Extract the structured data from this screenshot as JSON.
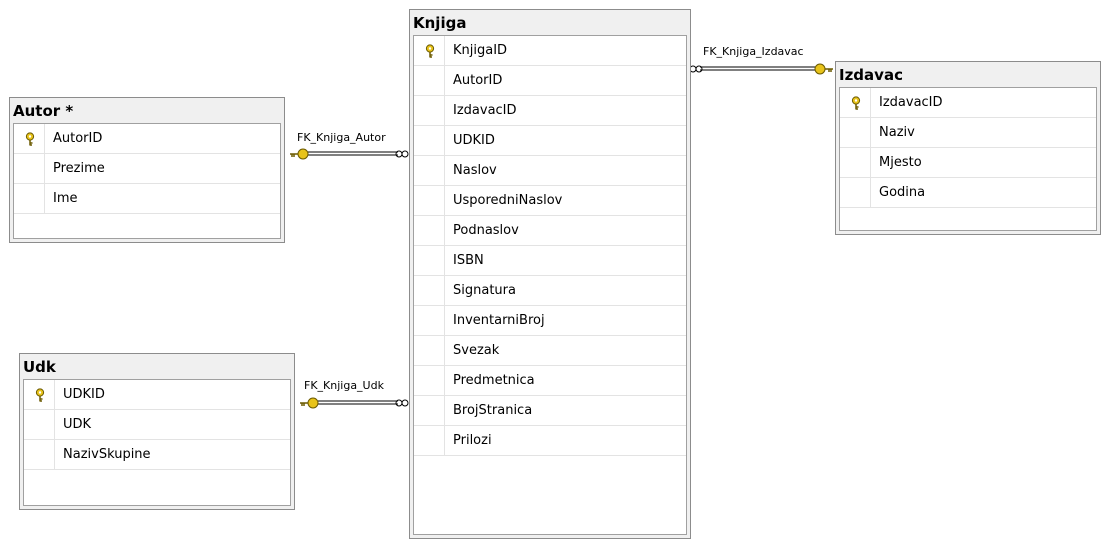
{
  "tables": {
    "autor": {
      "title": "Autor *",
      "columns": [
        "AutorID",
        "Prezime",
        "Ime"
      ]
    },
    "udk": {
      "title": "Udk",
      "columns": [
        "UDKID",
        "UDK",
        "NazivSkupine"
      ]
    },
    "knjiga": {
      "title": "Knjiga",
      "columns": [
        "KnjigaID",
        "AutorID",
        "IzdavacID",
        "UDKID",
        "Naslov",
        "UsporedniNaslov",
        "Podnaslov",
        "ISBN",
        "Signatura",
        "InventarniBroj",
        "Svezak",
        "Predmetnica",
        "BrojStranica",
        "Prilozi"
      ]
    },
    "izdavac": {
      "title": "Izdavac",
      "columns": [
        "IzdavacID",
        "Naziv",
        "Mjesto",
        "Godina"
      ]
    }
  },
  "relationships": {
    "autor": "FK_Knjiga_Autor",
    "udk": "FK_Knjiga_Udk",
    "izdavac": "FK_Knjiga_Izdavac"
  },
  "colors": {
    "key_icon": "#e8c31a",
    "table_border": "#8c8c8c",
    "background": "#ffffff"
  }
}
